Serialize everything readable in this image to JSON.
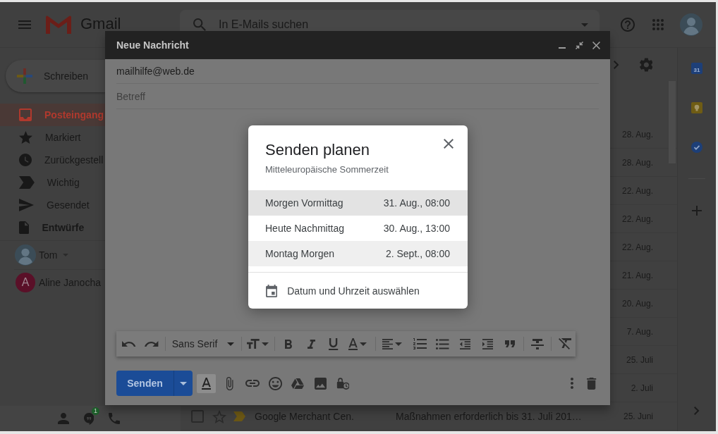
{
  "header": {
    "app_name": "Gmail",
    "search": {
      "placeholder": "In E-Mails suchen"
    }
  },
  "sidebar": {
    "compose_label": "Schreiben",
    "items": [
      {
        "label": "Posteingang",
        "selected": true,
        "has_items": false
      },
      {
        "label": "Markiert",
        "selected": false,
        "has_items": false
      },
      {
        "label": "Zurückgestell",
        "selected": false,
        "has_items": false
      },
      {
        "label": "Wichtig",
        "selected": false,
        "has_items": false
      },
      {
        "label": "Gesendet",
        "selected": false,
        "has_items": false
      },
      {
        "label": "Entwürfe",
        "selected": false,
        "has_items": true
      }
    ],
    "hangouts": {
      "user": "Tom",
      "contacts": [
        {
          "name": "Aline Janocha",
          "initial": "A"
        }
      ],
      "badge": "1"
    }
  },
  "emails": [
    {
      "date": "28. Aug."
    },
    {
      "date": "28. Aug."
    },
    {
      "date": "22. Aug."
    },
    {
      "date": "22. Aug."
    },
    {
      "date": "22. Aug."
    },
    {
      "date": "21. Aug."
    },
    {
      "date": "20. Aug."
    },
    {
      "date": "7. Aug."
    },
    {
      "date": "25. Juli"
    },
    {
      "date": "2. Juli"
    },
    {
      "sender": "Google Merchant Cen.",
      "subject": "Maßnahmen erforderlich bis 31. Juli 201…",
      "date": "25. Juni",
      "checked": false,
      "starred": false,
      "important": true
    }
  ],
  "right_panel": {
    "calendar_day": "31"
  },
  "compose": {
    "title": "Neue Nachricht",
    "to": "mailhilfe@web.de",
    "subject": {
      "placeholder": "Betreff"
    },
    "font": "Sans Serif",
    "send_label": "Senden",
    "formatting_shown": true
  },
  "schedule_dialog": {
    "title": "Senden planen",
    "timezone": "Mitteleuropäische Sommerzeit",
    "options": [
      {
        "label": "Morgen Vormittag",
        "time": "31. Aug., 08:00",
        "selected": true,
        "hovered": false
      },
      {
        "label": "Heute Nachmittag",
        "time": "30. Aug., 13:00",
        "selected": false,
        "hovered": false
      },
      {
        "label": "Montag Morgen",
        "time": "2. Sept., 08:00",
        "selected": false,
        "hovered": true
      }
    ],
    "custom_label": "Datum und Uhrzeit auswählen"
  }
}
